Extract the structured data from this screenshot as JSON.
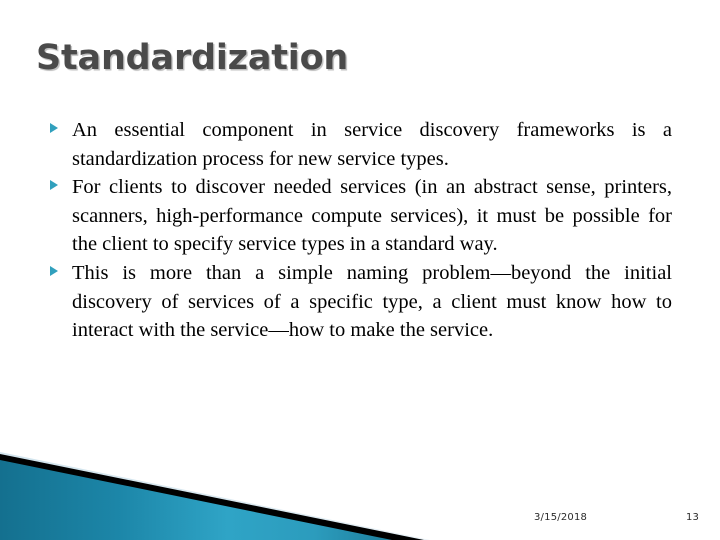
{
  "slide": {
    "title": "Standardization",
    "title_color": "#4a4a4a",
    "background_color": "#ffffff",
    "bullet_marker_color": "#31A0BD",
    "bullets": [
      {
        "marker": "triangle-right-bullet",
        "text": "An essential component in service discovery frameworks is a standardization process for new service types."
      },
      {
        "marker": "triangle-right-bullet",
        "text": "For clients to discover needed services (in an abstract sense, printers, scanners, high-performance compute services), it must be possible for the client to specify service types in a standard way."
      },
      {
        "marker": "triangle-right-bullet",
        "text": "This is more than a simple naming problem—beyond the initial discovery of services of a specific type, a client must know how to interact with the service—how to make the service."
      }
    ]
  },
  "footer": {
    "date": "3/15/2018",
    "page_number": "13"
  },
  "decoration": {
    "name": "bottom-left-diagonal-banner",
    "teal_dark": "#136E8E",
    "teal_mid": "#1E8CAF",
    "teal_light": "#3FB4D2",
    "stripe_black": "#000000",
    "pale_blue": "#DCE9F0"
  }
}
